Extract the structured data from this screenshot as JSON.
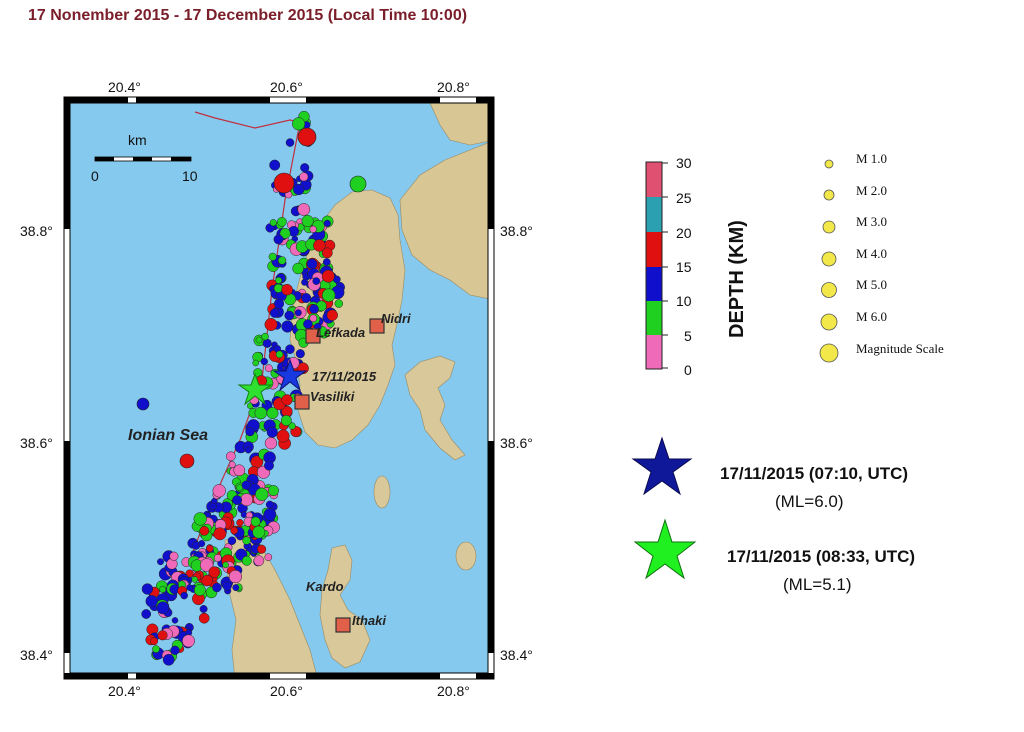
{
  "title": "17 Nonember 2015 - 17 December 2015 (Local Time 10:00)",
  "map": {
    "lon_ticks": [
      "20.4°",
      "20.6°",
      "20.8°"
    ],
    "lat_ticks": [
      "38.8°",
      "38.6°",
      "38.4°"
    ],
    "sea_label": "Ionian Sea",
    "place_labels": {
      "lefkada": "Lefkada",
      "nidri": "Nidri",
      "vasiliki": "Vasiliki",
      "kardo": "Kardo",
      "ithaki": "Ithaki"
    },
    "epicenter_label": "17/11/2015",
    "scale": {
      "unit": "km",
      "min": "0",
      "max": "10"
    },
    "colors": {
      "sea": "#86c9ee",
      "land": "#d9c89a",
      "fault": "#c03040",
      "town_marker": "#e0604a"
    }
  },
  "depth_legend": {
    "title": "DEPTH (KM)",
    "ticks": [
      "30",
      "25",
      "20",
      "15",
      "10",
      "5",
      "0"
    ],
    "colors": {
      "0-5": "#ef6ab8",
      "5-10": "#20d020",
      "10-15": "#1010cc",
      "15-20": "#e01010",
      "20-25": "#2aa0b0",
      "25-30": "#e05070"
    }
  },
  "magnitude_legend": {
    "items": [
      "M 1.0",
      "M 2.0",
      "M 3.0",
      "M 4.0",
      "M 5.0",
      "M 6.0"
    ],
    "footer": "Magnitude Scale",
    "color": "#f2e84a"
  },
  "events": [
    {
      "date": "17/11/2015 (07:10, UTC)",
      "ml": "(ML=6.0)",
      "icon": "blue-star-icon",
      "color": "#10189a"
    },
    {
      "date": "17/11/2015 (08:33, UTC)",
      "ml": "(ML=5.1)",
      "icon": "green-star-icon",
      "color": "#20f020"
    }
  ]
}
